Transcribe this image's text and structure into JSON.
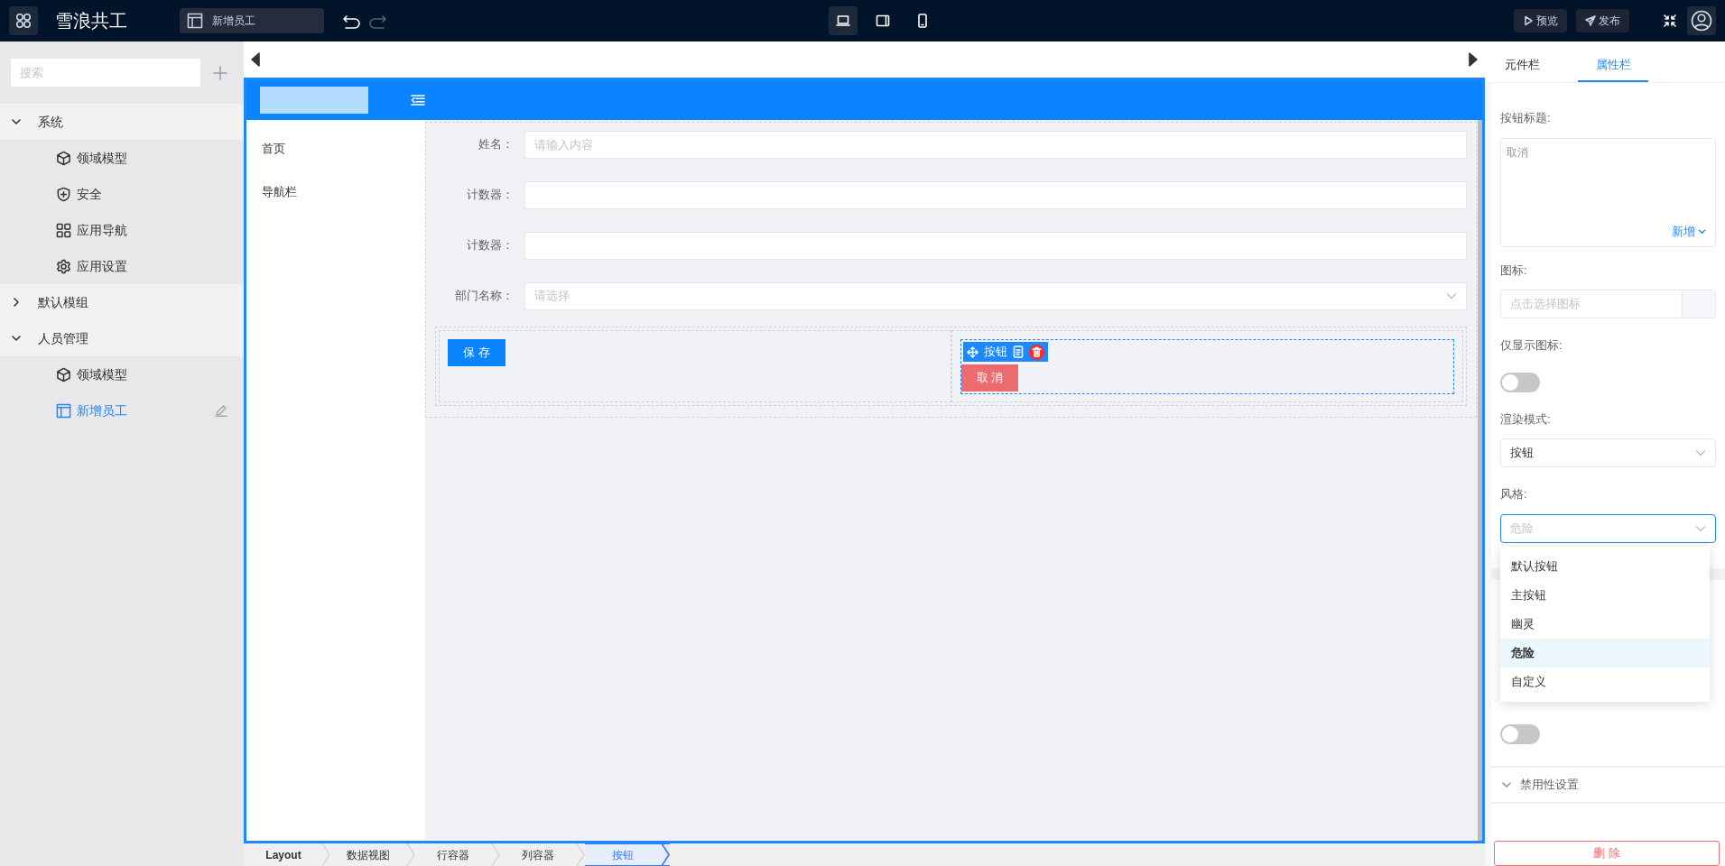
{
  "app": {
    "title": "雪浪共工"
  },
  "open_tab": {
    "label": "新增员工"
  },
  "devices": [
    {
      "kind": "desktop",
      "selected": true
    },
    {
      "kind": "tablet",
      "selected": false
    },
    {
      "kind": "phone",
      "selected": false
    }
  ],
  "actions": [
    {
      "kind": "preview",
      "label": "预览"
    },
    {
      "kind": "publish",
      "label": "发布"
    }
  ],
  "sidebar": {
    "search": {
      "placeholder": "搜索"
    },
    "tree": [
      {
        "label": "系统",
        "expanded": true,
        "children": [
          {
            "label": "领域模型",
            "kind": "model",
            "selected": false
          },
          {
            "label": "安全",
            "kind": "security",
            "selected": false
          },
          {
            "label": "应用导航",
            "kind": "nav",
            "selected": false
          },
          {
            "label": "应用设置",
            "kind": "settings",
            "selected": false
          }
        ]
      },
      {
        "label": "默认模组",
        "expanded": false
      },
      {
        "label": "人员管理",
        "expanded": true,
        "children": [
          {
            "label": "领域模型",
            "kind": "model",
            "selected": false
          },
          {
            "label": "新增员工",
            "kind": "page",
            "selected": true
          }
        ]
      }
    ]
  },
  "preview": {
    "nav_menu": [
      "首页",
      "导航栏"
    ],
    "fields": [
      {
        "label": "姓名：",
        "kind": "input",
        "placeholder": "请输入内容"
      },
      {
        "label": "计数器：",
        "kind": "input"
      },
      {
        "label": "计数器：",
        "kind": "input"
      },
      {
        "label": "部门名称：",
        "kind": "select",
        "placeholder": "请选择"
      }
    ],
    "columns": [
      {
        "selected": false,
        "button": {
          "label": "保 存",
          "kind": "primary"
        }
      },
      {
        "selected": true,
        "toolbar_label": "按钮",
        "button": {
          "label": "取 消",
          "kind": "danger"
        }
      }
    ]
  },
  "breadcrumb": [
    {
      "label": "Layout",
      "selected": false
    },
    {
      "label": "数据视图",
      "selected": false
    },
    {
      "label": "行容器",
      "selected": false
    },
    {
      "label": "列容器",
      "selected": false
    },
    {
      "label": "按钮",
      "selected": true
    }
  ],
  "properties": {
    "tabs": [
      {
        "label": "元件栏",
        "selected": false
      },
      {
        "label": "属性栏",
        "selected": true
      }
    ],
    "button_title": {
      "label": "按钮标题:",
      "value": "取消",
      "add_link": "新增"
    },
    "icon": {
      "label": "图标:",
      "placeholder": "点击选择图标"
    },
    "icon_only": {
      "label": "仅显示图标:",
      "on": false
    },
    "render_mode": {
      "label": "渲染模式:",
      "value": "按钮"
    },
    "style": {
      "label": "风格:",
      "placeholder": "危险",
      "options": [
        {
          "label": "默认按钮",
          "selected": false
        },
        {
          "label": "主按钮",
          "selected": false
        },
        {
          "label": "幽灵",
          "selected": false
        },
        {
          "label": "危险",
          "selected": true
        },
        {
          "label": "自定义",
          "selected": false
        }
      ]
    },
    "role_visible": {
      "on": false
    },
    "sections": [
      {
        "label": "禁用性设置",
        "expanded": false
      }
    ],
    "delete_button": "删 除"
  }
}
